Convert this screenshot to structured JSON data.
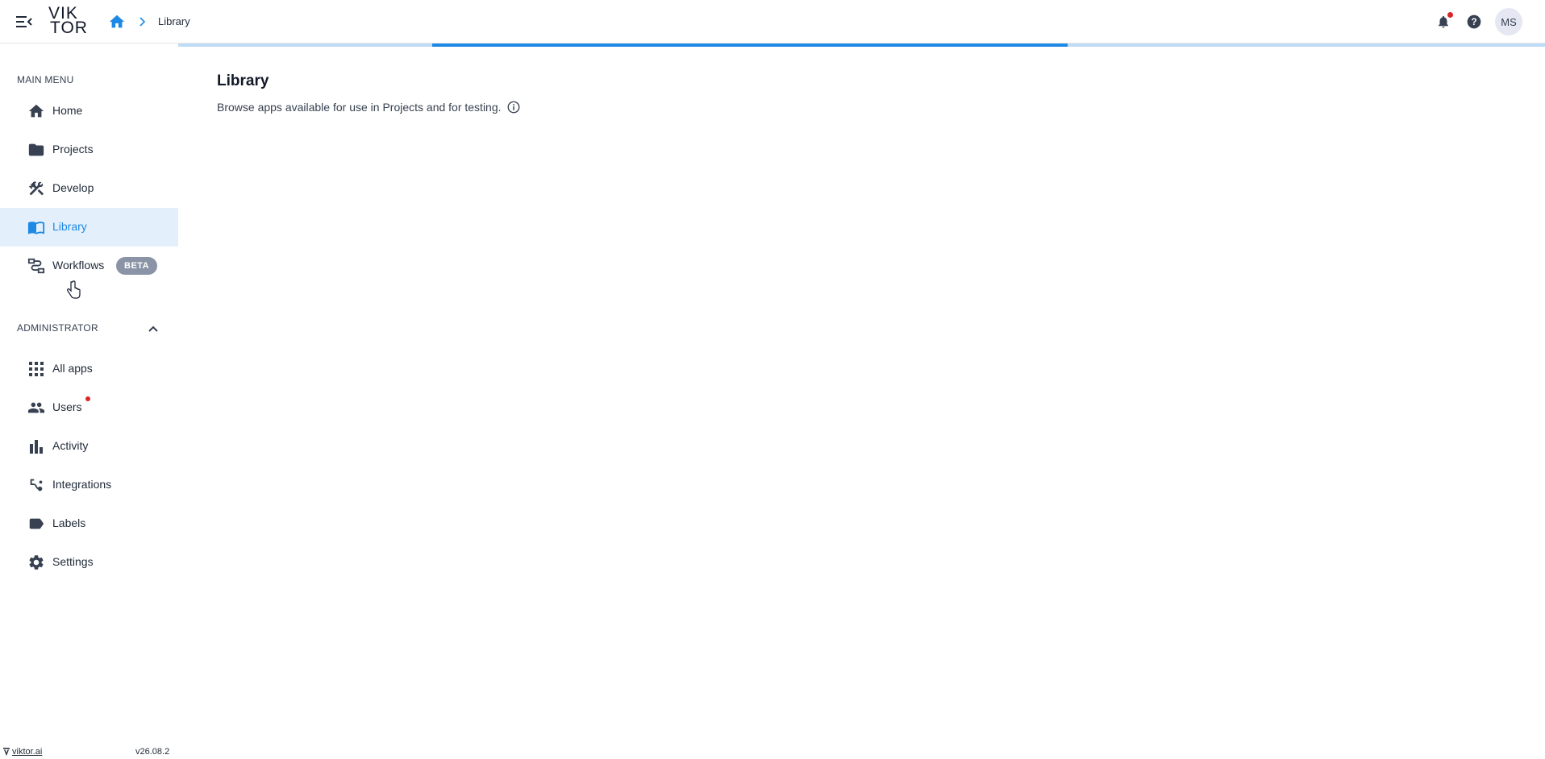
{
  "logo": {
    "line1": "VIK",
    "line2": "TOR"
  },
  "breadcrumb": {
    "current": "Library"
  },
  "header": {
    "avatar_initials": "MS"
  },
  "progress": {
    "fraction": 0.465
  },
  "sidebar": {
    "main_menu_label": "MAIN MENU",
    "main_items": [
      {
        "label": "Home",
        "icon": "home-icon"
      },
      {
        "label": "Projects",
        "icon": "folder-icon"
      },
      {
        "label": "Develop",
        "icon": "tools-icon"
      },
      {
        "label": "Library",
        "icon": "book-icon",
        "active": true
      },
      {
        "label": "Workflows",
        "icon": "workflow-icon",
        "badge": "BETA"
      }
    ],
    "admin_label": "ADMINISTRATOR",
    "admin_items": [
      {
        "label": "All apps",
        "icon": "apps-grid-icon"
      },
      {
        "label": "Users",
        "icon": "users-icon",
        "has_notification": true
      },
      {
        "label": "Activity",
        "icon": "bar-chart-icon"
      },
      {
        "label": "Integrations",
        "icon": "integrations-icon"
      },
      {
        "label": "Labels",
        "icon": "label-icon"
      },
      {
        "label": "Settings",
        "icon": "gear-icon"
      }
    ]
  },
  "footer": {
    "link": "viktor.ai",
    "version": "v26.08.2"
  },
  "main": {
    "title": "Library",
    "description": "Browse apps available for use in Projects and for testing."
  },
  "colors": {
    "accent": "#1e88e5",
    "active_bg": "#e3f0fc",
    "badge_bg": "#8a94a6",
    "dot": "#dc2626"
  }
}
